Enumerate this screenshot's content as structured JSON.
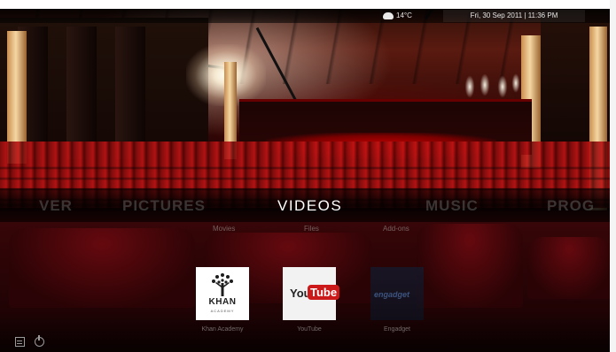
{
  "status": {
    "weather_icon": "cloud-icon",
    "temperature": "14°C",
    "datetime": "Fri, 30 Sep 2011 | 11:36 PM"
  },
  "main_menu": {
    "items": [
      {
        "label": "VER",
        "active": false
      },
      {
        "label": "PICTURES",
        "active": false
      },
      {
        "label": "VIDEOS",
        "active": true
      },
      {
        "label": "MUSIC",
        "active": false
      },
      {
        "label": "PROG",
        "active": false
      }
    ]
  },
  "submenu": {
    "items": [
      {
        "label": "Movies"
      },
      {
        "label": "Files"
      },
      {
        "label": "Add-ons"
      }
    ]
  },
  "addons": [
    {
      "label": "Khan Academy",
      "logo_title": "KHAN",
      "logo_subtitle": "ACADEMY"
    },
    {
      "label": "YouTube",
      "logo_you": "You",
      "logo_tube": "Tube"
    },
    {
      "label": "Engadget",
      "logo_text": "engadget"
    }
  ],
  "bottom_icons": [
    {
      "name": "favourites-icon"
    },
    {
      "name": "power-icon"
    }
  ],
  "colors": {
    "active_menu": "#ffffff",
    "inactive_menu": "#5f5f5f",
    "seat_red": "#c21414",
    "youtube_red": "#cc1a1a"
  }
}
